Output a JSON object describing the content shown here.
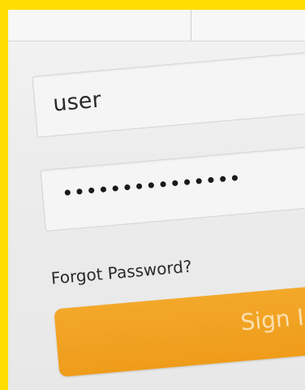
{
  "login_form": {
    "username_value": "user",
    "password_value": "•••••••••••••••",
    "forgot_password_label": "Forgot Password?",
    "sign_in_label": "Sign In"
  },
  "colors": {
    "frame_border": "#ffdd00",
    "sign_in_button": "#f0a020",
    "sign_in_text": "#fbe0b0"
  }
}
